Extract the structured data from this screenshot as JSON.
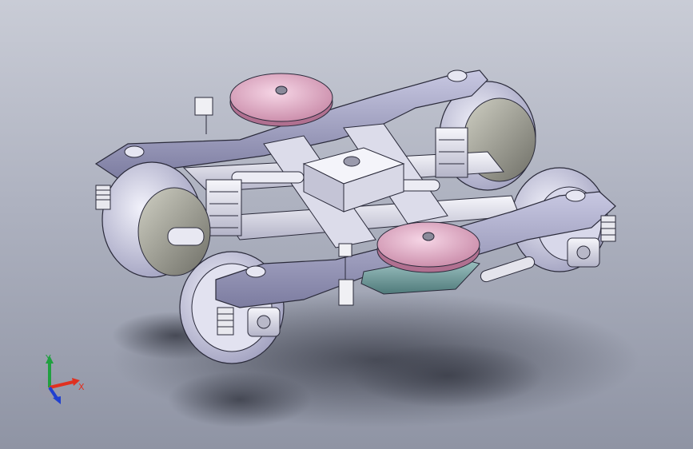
{
  "viewport": {
    "background_top": "#c9ccd6",
    "background_bottom": "#8f94a4"
  },
  "model": {
    "frame_color": "#a8a8c8",
    "wheel_color": "#d4d4ea",
    "tire_color": "#a8a89a",
    "pad_color": "#e4b6cc",
    "part_color": "#e8e8f0",
    "damper_color": "#7aa6a6"
  },
  "triad": {
    "x_label": "X",
    "y_label": "Y",
    "x_color": "#e03020",
    "y_color": "#20a040",
    "z_color": "#2040d0"
  }
}
